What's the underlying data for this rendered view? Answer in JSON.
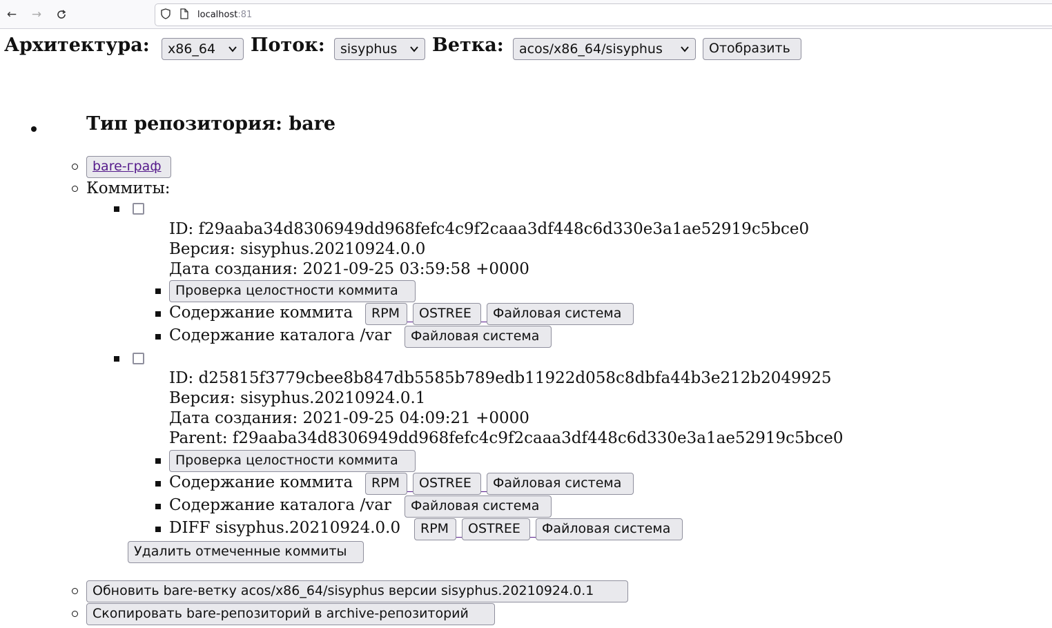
{
  "browser": {
    "host": "localhost",
    "port": ":81"
  },
  "selectors": {
    "arch_label": "Архитектура:",
    "arch_value": "x86_64",
    "stream_label": "Поток:",
    "stream_value": "sisyphus",
    "branch_label": "Ветка:",
    "branch_value": "acos/x86_64/sisyphus",
    "show_button": "Отобразить"
  },
  "repo": {
    "heading": "Тип репозитория: bare",
    "graph_link": "bare-граф",
    "commits_label": "Коммиты:",
    "commits": [
      {
        "id": "ID: f29aaba34d8306949dd968fefc4c9f2caaa3df448c6d330e3a1ae52919c5bce0",
        "version": "Версия: sisyphus.20210924.0.0",
        "date": "Дата создания: 2021-09-25 03:59:58 +0000",
        "check": "Проверка целостности коммита",
        "content_label": "Содержание коммита",
        "var_label": "Содержание каталога /var",
        "rpm": "RPM",
        "ostree": "OSTREE",
        "fs": "Файловая система"
      },
      {
        "id": "ID: d25815f3779cbee8b847db5585b789edb11922d058c8dbfa44b3e212b2049925",
        "version": "Версия: sisyphus.20210924.0.1",
        "date": "Дата создания: 2021-09-25 04:09:21 +0000",
        "parent": "Parent: f29aaba34d8306949dd968fefc4c9f2caaa3df448c6d330e3a1ae52919c5bce0",
        "check": "Проверка целостности коммита",
        "content_label": "Содержание коммита",
        "var_label": "Содержание каталога /var",
        "diff_label": "DIFF sisyphus.20210924.0.0",
        "rpm": "RPM",
        "ostree": "OSTREE",
        "fs": "Файловая система"
      }
    ],
    "delete_button": "Удалить отмеченные коммиты",
    "update_button": "Обновить bare-ветку acos/x86_64/sisyphus версии sisyphus.20210924.0.1",
    "copy_button": "Скопировать bare-репозиторий в archive-репозиторий"
  }
}
